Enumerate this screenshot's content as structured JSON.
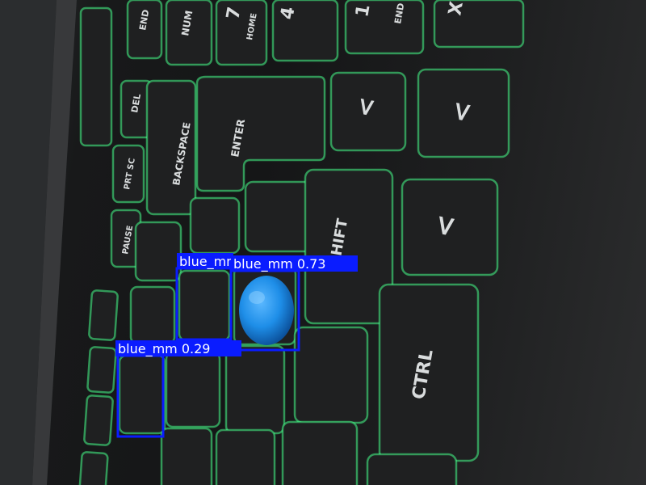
{
  "keys": {
    "end": "END",
    "num": "NUM",
    "home_7": "7",
    "home": "HOME",
    "four": "4",
    "one": "1",
    "end2": "END",
    "x": "X",
    "del": "DEL",
    "enter": "ENTER",
    "backspace": "BACKSPACE",
    "prtsc": "PRT SC",
    "shift": "SHIFT",
    "ctrl": "CTRL",
    "pause": "PAUSE"
  },
  "detections": [
    {
      "label": "blue_mm"
    },
    {
      "label": "blue_mm  0.73"
    },
    {
      "label": "blue_mm  0.29"
    }
  ],
  "colors": {
    "box": "#0a1cff",
    "candy": "#1e8ee8",
    "backlight": "#46ff8a"
  }
}
